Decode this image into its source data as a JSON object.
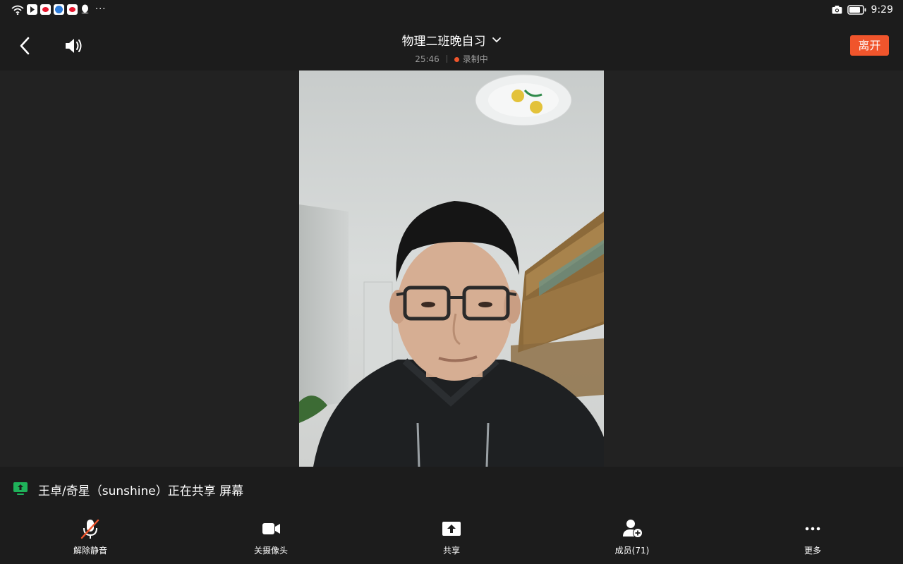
{
  "status_bar": {
    "time": "9:29",
    "more_dots": "···",
    "left_icons": [
      "wifi-icon",
      "notification-app-icon",
      "weibo-icon",
      "browser-icon",
      "weibo-icon",
      "qq-icon"
    ],
    "right_icons": [
      "camera-icon",
      "battery-icon"
    ]
  },
  "header": {
    "title": "物理二班晚自习",
    "elapsed": "25:46",
    "recording_label": "录制中",
    "leave_label": "离开"
  },
  "share_banner": {
    "text": "王卓/奇星（sunshine）正在共享 屏幕"
  },
  "toolbar": {
    "unmute_label": "解除静音",
    "camera_off_label": "关摄像头",
    "share_label": "共享",
    "members_label": "成员(71)",
    "more_label": "更多"
  },
  "colors": {
    "accent": "#f0552c",
    "share_green": "#1fb25a",
    "background": "#1c1c1c"
  }
}
